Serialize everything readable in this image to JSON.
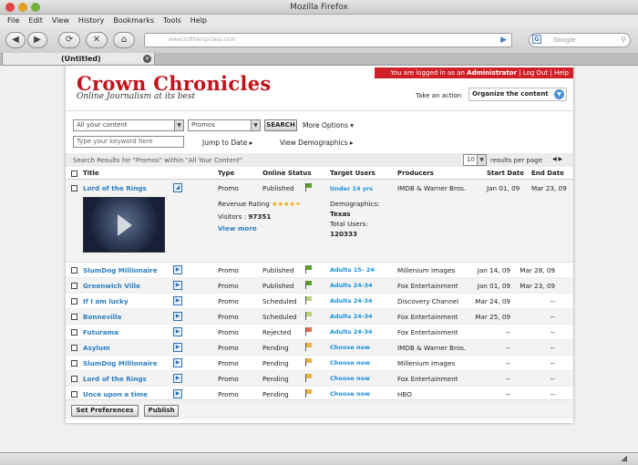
{
  "browser": {
    "window_title": "Mozilla Firefox",
    "menu": [
      "File",
      "Edit",
      "View",
      "History",
      "Bookmarks",
      "Tools",
      "Help"
    ],
    "url": "www.lcdlhempclass.com",
    "search_placeholder": "Google",
    "tab_title": "(Untitled)"
  },
  "site": {
    "brand": "Crown Chronicles",
    "tagline": "Online Journalism at its best",
    "login_prefix": "You are logged in as an",
    "login_user": "Administrator",
    "logout": "Log Out",
    "help": "Help",
    "take_action": "Take an action",
    "organize": "Organize the content"
  },
  "filters": {
    "content_select": "All your content",
    "type_select": "Promos",
    "search_btn": "SEARCH",
    "more_options": "More Options ▾",
    "keyword_placeholder": "Type your keyword here",
    "jump_to_date": "Jump to Date ▸",
    "view_demographics": "View Demographics ▸",
    "results_info": "Search Results for \"Promos\" within \"All Your Content\"",
    "per_page_value": "10",
    "per_page_label": "results per page"
  },
  "table": {
    "headers": [
      "Title",
      "Type",
      "Online Status",
      "Target Users",
      "Producers",
      "Start Date",
      "End Date"
    ],
    "expanded": {
      "title": "Lord of the Rings",
      "type": "Promo",
      "status": "Published",
      "status_color": "#5aa12a",
      "target": "Under 14 yrs",
      "producer": "IMDB & Warner Bros.",
      "start": "Jan 01, 09",
      "end": "Mar 23, 09",
      "rating_label": "Revenue Rating",
      "stars": "★★★★✶",
      "visitors_label": "Visitors :",
      "visitors": "97351",
      "view_more": "View more",
      "demographics_label": "Demographics:",
      "demographics_value": "Texas",
      "total_users_label": "Total Users:",
      "total_users": "120333"
    },
    "rows": [
      {
        "title": "SlumDog Millionaire",
        "type": "Promo",
        "status": "Published",
        "color": "#5aa12a",
        "target": "Adults 15- 24",
        "producer": "Millenium Images",
        "start": "Jan 14, 09",
        "end": "Mar 28, 09"
      },
      {
        "title": "Greenwich Ville",
        "type": "Promo",
        "status": "Published",
        "color": "#5aa12a",
        "target": "Adults 24-34",
        "producer": "Fox Entertainment",
        "start": "Jan 01, 09",
        "end": "Mar 23, 09"
      },
      {
        "title": "If I am lucky",
        "type": "Promo",
        "status": "Scheduled",
        "color": "#b9d37a",
        "target": "Adults 24-34",
        "producer": "Discovery Channel",
        "start": "Mar 24, 09",
        "end": "--"
      },
      {
        "title": "Bonneville",
        "type": "Promo",
        "status": "Scheduled",
        "color": "#b9d37a",
        "target": "Adults 24-34",
        "producer": "Fox Entertainment",
        "start": "Mar 25, 09",
        "end": "--"
      },
      {
        "title": "Futurama",
        "type": "Promo",
        "status": "Rejected",
        "color": "#e06a4a",
        "target": "Adults 24-34",
        "producer": "Fox Entertainment",
        "start": "--",
        "end": "--"
      },
      {
        "title": "Asylum",
        "type": "Promo",
        "status": "Pending",
        "color": "#f0b23a",
        "target": "Choose now",
        "producer": "IMDB & Warner Bros.",
        "start": "--",
        "end": "--"
      },
      {
        "title": "SlumDog Millionaire",
        "type": "Promo",
        "status": "Pending",
        "color": "#f0b23a",
        "target": "Choose now",
        "producer": "Millenium Images",
        "start": "--",
        "end": "--"
      },
      {
        "title": "Lord of the Rings",
        "type": "Promo",
        "status": "Pending",
        "color": "#f0b23a",
        "target": "Choose now",
        "producer": "Fox Entertainment",
        "start": "--",
        "end": "--"
      },
      {
        "title": "Unce upon a time",
        "type": "Promo",
        "status": "Pending",
        "color": "#f0b23a",
        "target": "Choose now",
        "producer": "HBO",
        "start": "--",
        "end": "--"
      }
    ]
  },
  "footer": {
    "set_preferences": "Set Preferences",
    "publish": "Publish"
  }
}
